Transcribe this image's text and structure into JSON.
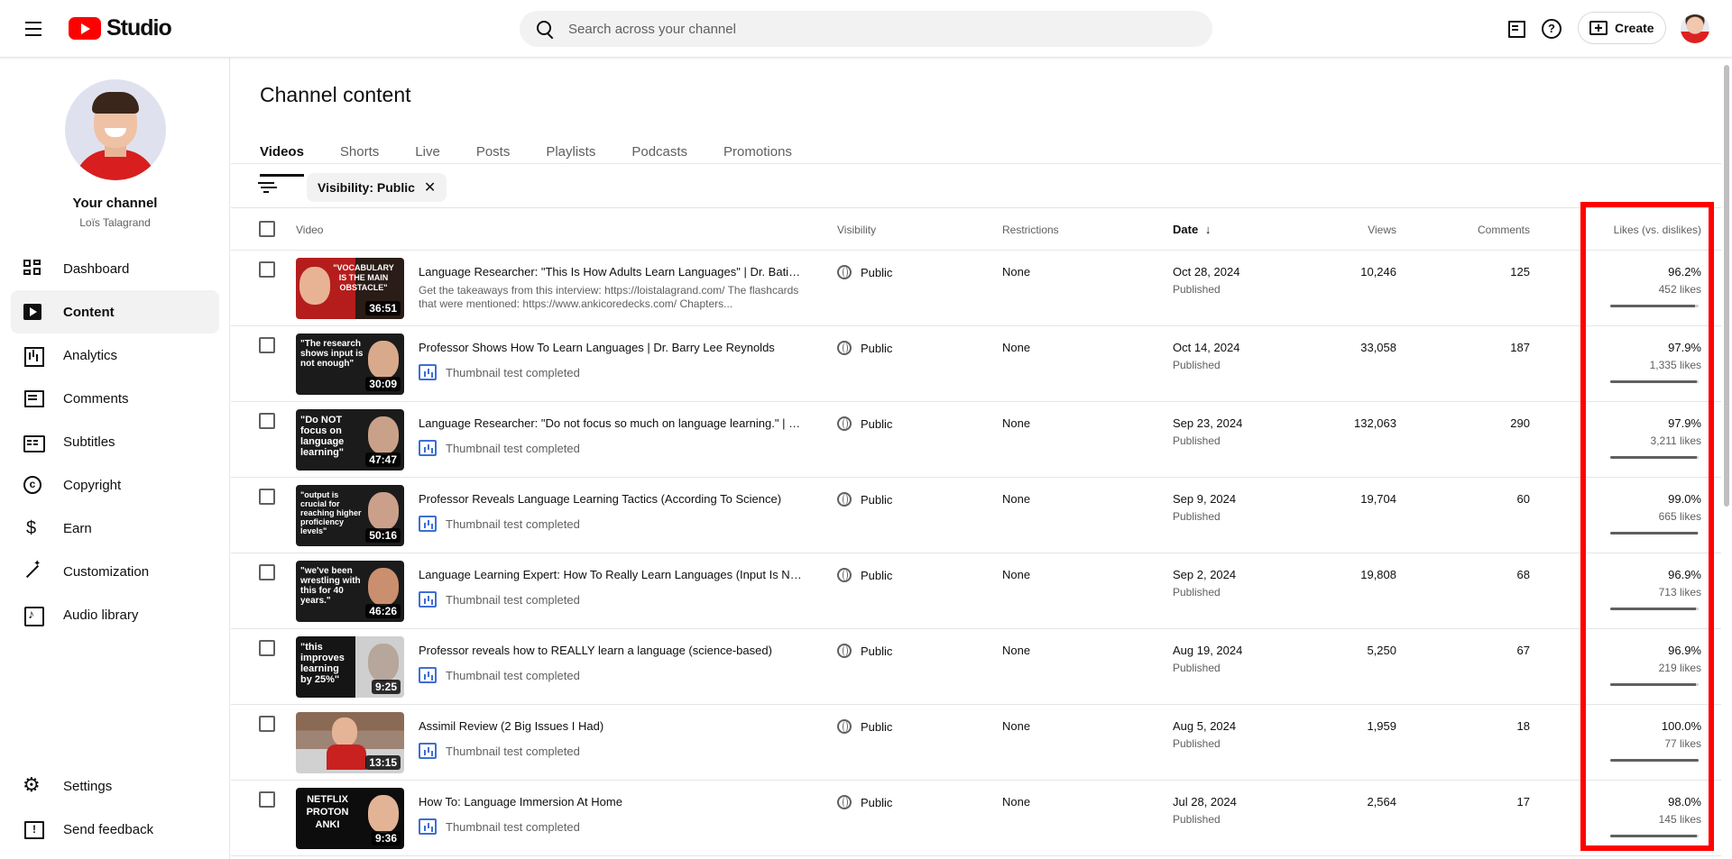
{
  "header": {
    "logo_text": "Studio",
    "search_placeholder": "Search across your channel",
    "create_label": "Create"
  },
  "sidebar": {
    "channel_title": "Your channel",
    "channel_name": "Loïs Talagrand",
    "items": [
      {
        "label": "Dashboard",
        "icon": "dashboard-icon"
      },
      {
        "label": "Content",
        "icon": "content-icon",
        "active": true
      },
      {
        "label": "Analytics",
        "icon": "analytics-icon"
      },
      {
        "label": "Comments",
        "icon": "comments-icon"
      },
      {
        "label": "Subtitles",
        "icon": "subtitles-icon"
      },
      {
        "label": "Copyright",
        "icon": "copyright-icon"
      },
      {
        "label": "Earn",
        "icon": "earn-icon"
      },
      {
        "label": "Customization",
        "icon": "customization-icon"
      },
      {
        "label": "Audio library",
        "icon": "audio-library-icon"
      }
    ],
    "bottom_items": [
      {
        "label": "Settings",
        "icon": "settings-icon"
      },
      {
        "label": "Send feedback",
        "icon": "send-feedback-icon"
      }
    ]
  },
  "main": {
    "title": "Channel content",
    "tabs": [
      "Videos",
      "Shorts",
      "Live",
      "Posts",
      "Playlists",
      "Podcasts",
      "Promotions"
    ],
    "filter_chip": "Visibility: Public",
    "columns": {
      "video": "Video",
      "visibility": "Visibility",
      "restrictions": "Restrictions",
      "date": "Date",
      "views": "Views",
      "comments": "Comments",
      "likes": "Likes (vs. dislikes)"
    },
    "rows": [
      {
        "thumb_text": "\"VOCABULARY IS THE MAIN OBSTACLE\"",
        "duration": "36:51",
        "title": "Language Researcher: \"This Is How Adults Learn Languages\" | Dr. Batia Laufer",
        "description": "Get the takeaways from this interview: https://loistalagrand.com/ The flashcards that were mentioned: https://www.ankicoredecks.com/ Chapters...",
        "sub": "",
        "visibility": "Public",
        "restrictions": "None",
        "date": "Oct 28, 2024",
        "status": "Published",
        "views": "10,246",
        "comments": "125",
        "likes_pct": "96.2%",
        "likes_count": "452 likes",
        "likes_ratio": 0.962
      },
      {
        "thumb_text": "\"The research shows input is not enough\"",
        "duration": "30:09",
        "title": "Professor Shows How To Learn Languages | Dr. Barry Lee Reynolds",
        "description": "",
        "sub": "Thumbnail test completed",
        "visibility": "Public",
        "restrictions": "None",
        "date": "Oct 14, 2024",
        "status": "Published",
        "views": "33,058",
        "comments": "187",
        "likes_pct": "97.9%",
        "likes_count": "1,335 likes",
        "likes_ratio": 0.979
      },
      {
        "thumb_text": "\"Do NOT focus on language learning\"",
        "duration": "47:47",
        "title": "Language Researcher: \"Do not focus so much on language learning.\" | Dr. Jack C. Richards",
        "description": "",
        "sub": "Thumbnail test completed",
        "visibility": "Public",
        "restrictions": "None",
        "date": "Sep 23, 2024",
        "status": "Published",
        "views": "132,063",
        "comments": "290",
        "likes_pct": "97.9%",
        "likes_count": "3,211 likes",
        "likes_ratio": 0.979
      },
      {
        "thumb_text": "\"output is crucial for reaching higher proficiency levels\"",
        "duration": "50:16",
        "title": "Professor Reveals Language Learning Tactics (According To Science)",
        "description": "",
        "sub": "Thumbnail test completed",
        "visibility": "Public",
        "restrictions": "None",
        "date": "Sep 9, 2024",
        "status": "Published",
        "views": "19,704",
        "comments": "60",
        "likes_pct": "99.0%",
        "likes_count": "665 likes",
        "likes_ratio": 0.99
      },
      {
        "thumb_text": "\"we've been wrestling with this for 40 years.\"",
        "duration": "46:26",
        "title": "Language Learning Expert: How To Really Learn Languages (Input Is Not Enough)",
        "description": "",
        "sub": "Thumbnail test completed",
        "visibility": "Public",
        "restrictions": "None",
        "date": "Sep 2, 2024",
        "status": "Published",
        "views": "19,808",
        "comments": "68",
        "likes_pct": "96.9%",
        "likes_count": "713 likes",
        "likes_ratio": 0.969
      },
      {
        "thumb_text": "\"this improves learning by 25%\"",
        "duration": "9:25",
        "title": "Professor reveals how to REALLY learn a language (science-based)",
        "description": "",
        "sub": "Thumbnail test completed",
        "visibility": "Public",
        "restrictions": "None",
        "date": "Aug 19, 2024",
        "status": "Published",
        "views": "5,250",
        "comments": "67",
        "likes_pct": "96.9%",
        "likes_count": "219 likes",
        "likes_ratio": 0.969
      },
      {
        "thumb_text": "",
        "duration": "13:15",
        "title": "Assimil Review (2 Big Issues I Had)",
        "description": "",
        "sub": "Thumbnail test completed",
        "visibility": "Public",
        "restrictions": "None",
        "date": "Aug 5, 2024",
        "status": "Published",
        "views": "1,959",
        "comments": "18",
        "likes_pct": "100.0%",
        "likes_count": "77 likes",
        "likes_ratio": 1.0
      },
      {
        "thumb_text": "NETFLIX PROTON ANKI",
        "duration": "9:36",
        "title": "How To: Language Immersion At Home",
        "description": "",
        "sub": "Thumbnail test completed",
        "visibility": "Public",
        "restrictions": "None",
        "date": "Jul 28, 2024",
        "status": "Published",
        "views": "2,564",
        "comments": "17",
        "likes_pct": "98.0%",
        "likes_count": "145 likes",
        "likes_ratio": 0.98
      }
    ]
  },
  "colors": {
    "brand_red": "#ff0000",
    "highlight_box": "#ff0000",
    "thumbnail_test_icon": "#3e6ed4"
  }
}
